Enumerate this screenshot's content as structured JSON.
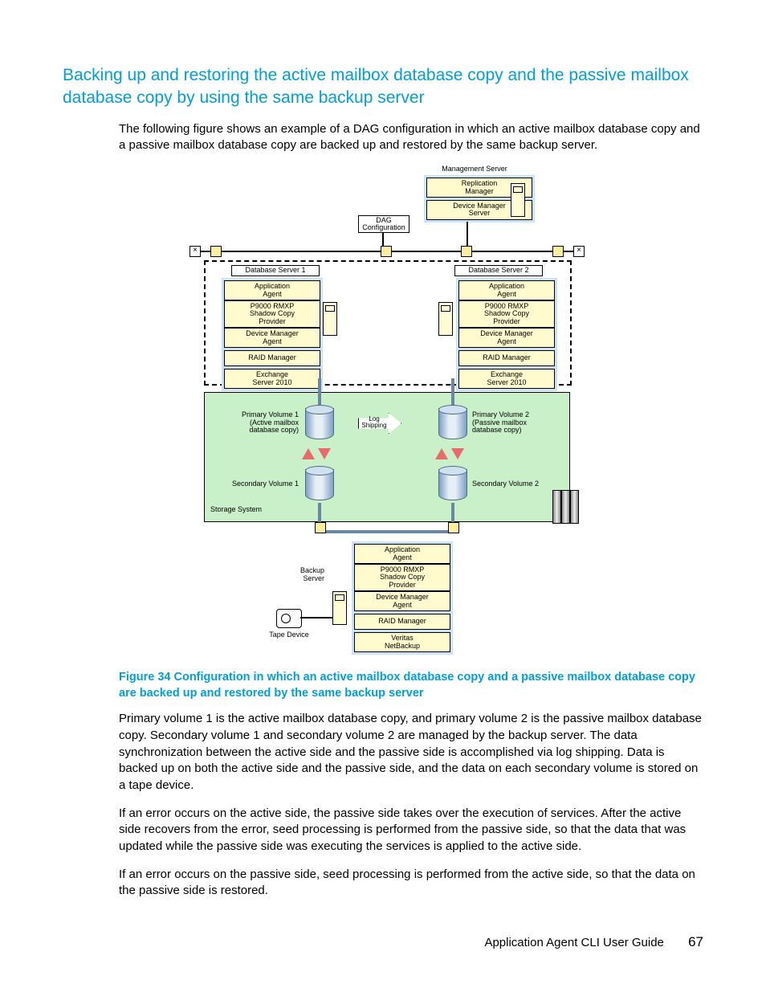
{
  "section_heading": "Backing up and restoring the active mailbox database copy and the passive mailbox database copy by using the same backup server",
  "intro": "The following figure shows an example of a DAG configuration in which an active mailbox database copy and a passive mailbox database copy are backed up and restored by the same backup server.",
  "figure_caption": "Figure 34 Configuration in which an active mailbox database copy and a passive mailbox database copy are backed up and restored by the same backup server",
  "p1": "Primary volume 1 is the active mailbox database copy, and primary volume 2 is the passive mailbox database copy. Secondary volume 1 and secondary volume 2 are managed by the backup server. The data synchronization between the active side and the passive side is accomplished via log shipping. Data is backed up on both the active side and the passive side, and the data on each secondary volume is stored on a tape device.",
  "p2": "If an error occurs on the active side, the passive side takes over the execution of services. After the active side recovers from the error, seed processing is performed from the passive side, so that the data that was updated while the passive side was executing the services is applied to the active side.",
  "p3": "If an error occurs on the passive side, seed processing is performed from the active side, so that the data on the passive side is restored.",
  "footer_title": "Application Agent CLI User Guide",
  "page_number": "67",
  "diagram": {
    "mgmt_server_label": "Management Server",
    "mgmt": {
      "repl": "Replication\nManager",
      "dev": "Device Manager\nServer"
    },
    "dag_config": "DAG\nConfiguration",
    "db1_label": "Database Server 1",
    "db2_label": "Database Server 2",
    "db_stack": {
      "app": "Application\nAgent",
      "p9000": "P9000 RMXP\nShadow Copy\nProvider",
      "dma": "Device Manager\nAgent",
      "raid": "RAID Manager",
      "exch": "Exchange\nServer 2010"
    },
    "pv1": "Primary Volume 1\n(Active mailbox\ndatabase copy)",
    "pv2": "Primary Volume 2\n(Passive mailbox\ndatabase copy)",
    "sv1": "Secondary Volume 1",
    "sv2": "Secondary Volume 2",
    "log_ship": "Log Shipping",
    "storage": "Storage System",
    "backup_server": "Backup\nServer",
    "backup_stack": {
      "app": "Application\nAgent",
      "p9000": "P9000 RMXP\nShadow Copy\nProvider",
      "dma": "Device Manager\nAgent",
      "raid": "RAID Manager",
      "nbu": "Veritas\nNetBackup"
    },
    "tape": "Tape Device"
  }
}
